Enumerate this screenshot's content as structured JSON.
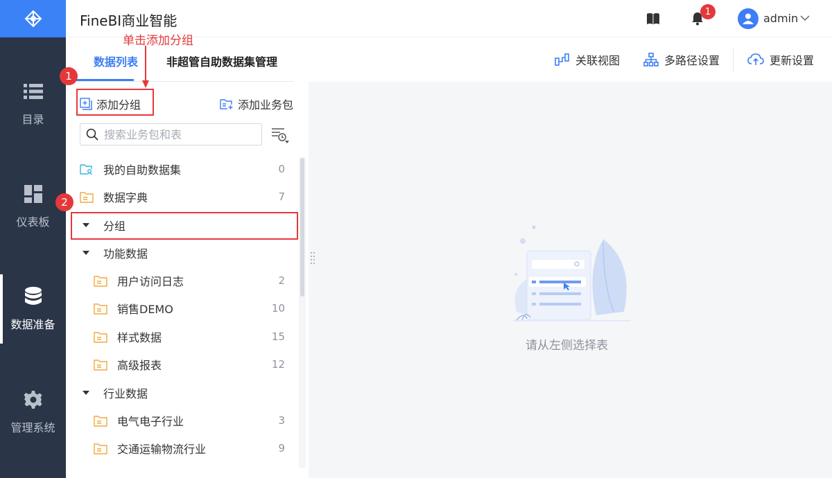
{
  "app": {
    "title": "FineBI商业智能"
  },
  "header": {
    "notification_count": "1",
    "username": "admin"
  },
  "leftnav": {
    "items": [
      {
        "label": "目录",
        "icon": "list-icon",
        "active": false
      },
      {
        "label": "仪表板",
        "icon": "dashboard-icon",
        "active": false
      },
      {
        "label": "数据准备",
        "icon": "database-icon",
        "active": true
      },
      {
        "label": "管理系统",
        "icon": "gear-icon",
        "active": false
      }
    ]
  },
  "tabs": {
    "data_list": "数据列表",
    "self_service": "非超管自助数据集管理"
  },
  "actions": {
    "relation_view": "关联视图",
    "multi_path": "多路径设置",
    "update_settings": "更新设置"
  },
  "panel": {
    "add_group": "添加分组",
    "add_package": "添加业务包",
    "search_placeholder": "搜索业务包和表",
    "items": [
      {
        "label": "我的自助数据集",
        "count": "0"
      },
      {
        "label": "数据字典",
        "count": "7"
      },
      {
        "label": "分组",
        "count": ""
      },
      {
        "label": "功能数据",
        "count": ""
      },
      {
        "label": "用户访问日志",
        "count": "2"
      },
      {
        "label": "销售DEMO",
        "count": "10"
      },
      {
        "label": "样式数据",
        "count": "15"
      },
      {
        "label": "高级报表",
        "count": "12"
      },
      {
        "label": "行业数据",
        "count": ""
      },
      {
        "label": "电气电子行业",
        "count": "3"
      },
      {
        "label": "交通运输物流行业",
        "count": "9"
      }
    ]
  },
  "main": {
    "empty_text": "请从左侧选择表"
  },
  "annotations": {
    "step1": "1",
    "step2": "2",
    "hint": "单击添加分组"
  },
  "colors": {
    "accent": "#3d7ef5",
    "nav_bg": "#2b3548",
    "annotation": "#e5383b",
    "folder": "#f2a93b"
  }
}
